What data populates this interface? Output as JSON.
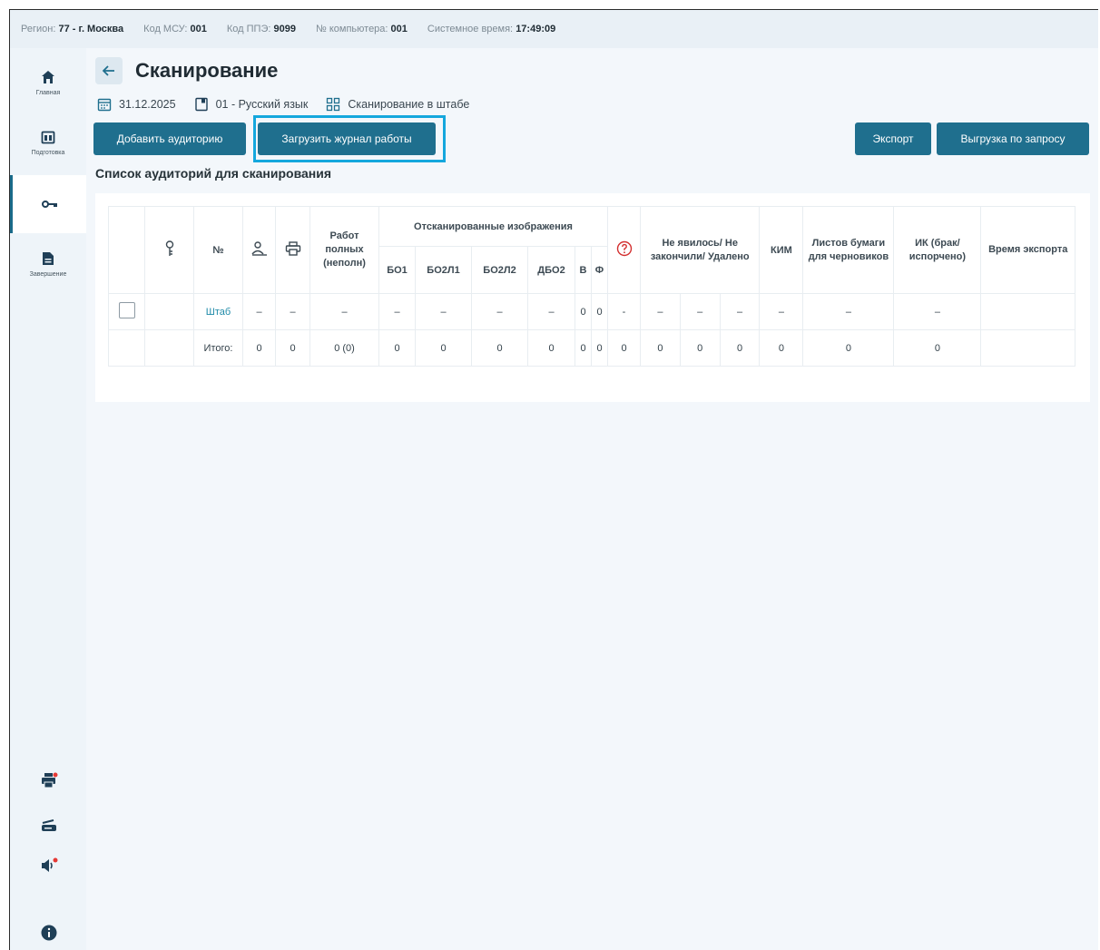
{
  "statusbar": {
    "region_label": "Регион:",
    "region_value": "77 - г. Москва",
    "msu_label": "Код МСУ:",
    "msu_value": "001",
    "ppe_label": "Код ППЭ:",
    "ppe_value": "9099",
    "pc_label": "№ компьютера:",
    "pc_value": "001",
    "time_label": "Системное время:",
    "time_value": "17:49:09"
  },
  "sidebar": {
    "items": [
      {
        "label": "Главная",
        "icon": "home-icon"
      },
      {
        "label": "Подготовка",
        "icon": "calendar-icon"
      },
      {
        "label": "",
        "icon": "key-icon",
        "active": true
      },
      {
        "label": "Завершение",
        "icon": "document-icon"
      }
    ],
    "tools": [
      "printer-alert-icon",
      "scanner-icon",
      "sound-alert-icon",
      "info-icon"
    ]
  },
  "page": {
    "title": "Сканирование",
    "date": "31.12.2025",
    "subject": "01 - Русский язык",
    "mode": "Сканирование в штабе",
    "section_title": "Список аудиторий для сканирования"
  },
  "buttons": {
    "add_auditorium": "Добавить аудиторию",
    "upload_journal": "Загрузить журнал работы",
    "export": "Экспорт",
    "export_request": "Выгрузка по запросу"
  },
  "colors": {
    "primary": "#1f6f8e",
    "highlight": "#14a7dd",
    "link": "#1f8aa8",
    "alert": "#d32f2f"
  },
  "table": {
    "headers": {
      "no": "№",
      "works": "Работ полных (неполн)",
      "scanned": "Отсканированные изображения",
      "bo1": "БО1",
      "bo2l1": "БО2Л1",
      "bo2l2": "БО2Л2",
      "dbo2": "ДБО2",
      "v": "В",
      "f": "Ф",
      "absent": "Не явилось/ Не закончили/ Удалено",
      "kim": "КИМ",
      "sheets": "Листов бумаги для черновиков",
      "ik": "ИК (брак/ испорчено)",
      "export_time": "Время экспорта"
    },
    "row": {
      "name": "Штаб",
      "c1": "–",
      "c2": "–",
      "works": "–",
      "bo1": "–",
      "bo2l1": "–",
      "bo2l2": "–",
      "dbo2": "–",
      "v": "0",
      "f": "0",
      "q": "-",
      "a1": "–",
      "a2": "–",
      "a3": "–",
      "kim": "–",
      "sheets": "–",
      "ik": "–",
      "time": ""
    },
    "total": {
      "label": "Итого:",
      "c1": "0",
      "c2": "0",
      "works": "0 (0)",
      "bo1": "0",
      "bo2l1": "0",
      "bo2l2": "0",
      "dbo2": "0",
      "v": "0",
      "f": "0",
      "q": "0",
      "a1": "0",
      "a2": "0",
      "a3": "0",
      "kim": "0",
      "sheets": "0",
      "ik": "0",
      "time": ""
    }
  }
}
